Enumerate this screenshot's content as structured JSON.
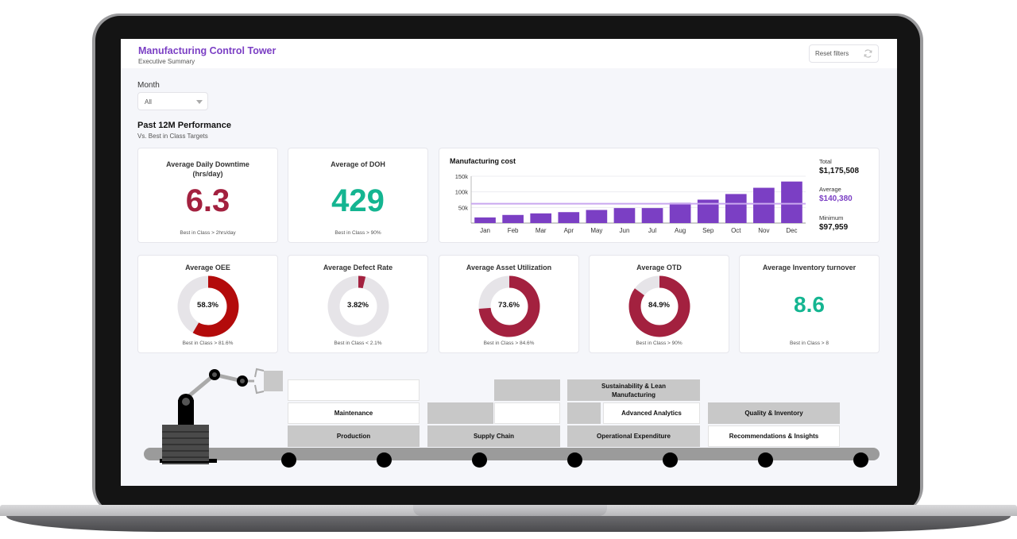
{
  "header": {
    "title": "Manufacturing Control Tower",
    "subtitle": "Executive Summary",
    "reset_label": "Reset filters"
  },
  "filters": {
    "month_label": "Month",
    "month_value": "All"
  },
  "section": {
    "title": "Past 12M Performance",
    "subtitle": "Vs. Best in Class Targets"
  },
  "kpis": {
    "downtime": {
      "title": "Average Daily Downtime (hrs/day)",
      "value": "6.3",
      "target": "Best in Class > 2hrs/day",
      "color": "#a3213f"
    },
    "doh": {
      "title": "Average of DOH",
      "value": "429",
      "target": "Best in Class > 90%",
      "color": "#14b591"
    },
    "inventory": {
      "title": "Average Inventory turnover",
      "value": "8.6",
      "target": "Best in Class > 8",
      "color": "#14b591"
    }
  },
  "donuts": [
    {
      "title": "Average OEE",
      "label": "58.3%",
      "percent": 58.3,
      "target": "Best in Class > 81.6%",
      "color": "#b30b0b"
    },
    {
      "title": "Average Defect Rate",
      "label": "3.82%",
      "percent": 3.82,
      "target": "Best in Class < 2.1%",
      "color": "#a3213f"
    },
    {
      "title": "Average Asset Utilization",
      "label": "73.6%",
      "percent": 73.6,
      "target": "Best in Class > 84.6%",
      "color": "#a3213f"
    },
    {
      "title": "Average OTD",
      "label": "84.9%",
      "percent": 84.9,
      "target": "Best in Class > 90%",
      "color": "#a3213f"
    }
  ],
  "cost_stats": {
    "total_label": "Total",
    "total_value": "$1,175,508",
    "average_label": "Average",
    "average_value": "$140,380",
    "minimum_label": "Minimum",
    "minimum_value": "$97,959",
    "average_color": "#7b3fc4"
  },
  "chart_data": {
    "type": "bar",
    "title": "Manufacturing cost",
    "categories": [
      "Jan",
      "Feb",
      "Mar",
      "Apr",
      "May",
      "Jun",
      "Jul",
      "Aug",
      "Sep",
      "Oct",
      "Nov",
      "Dec"
    ],
    "values": [
      18000,
      26000,
      31000,
      35000,
      42000,
      48000,
      48000,
      65000,
      75000,
      93000,
      113000,
      133000
    ],
    "reference_line": 62000,
    "ylim": [
      0,
      150000
    ],
    "yticks": [
      50000,
      100000,
      150000
    ],
    "ytick_labels": [
      "50k",
      "100k",
      "150k"
    ],
    "xlabel": "",
    "ylabel": "",
    "grid": true,
    "bar_color": "#7b3fc4",
    "line_color": "#c9a8ef"
  },
  "roadmap": {
    "blocks": [
      {
        "id": "empty-top-1",
        "label": "",
        "style": "white"
      },
      {
        "id": "maintenance",
        "label": "Maintenance",
        "style": "white"
      },
      {
        "id": "production",
        "label": "Production",
        "style": "gray"
      },
      {
        "id": "empty-top-2",
        "label": "",
        "style": "gray"
      },
      {
        "id": "empty-mid-2a",
        "label": "",
        "style": "gray"
      },
      {
        "id": "empty-mid-2b",
        "label": "",
        "style": "white"
      },
      {
        "id": "supply-chain",
        "label": "Supply Chain",
        "style": "gray"
      },
      {
        "id": "sustainability",
        "label": "Sustainability & Lean Manufacturing",
        "style": "gray"
      },
      {
        "id": "empty-mid-3",
        "label": "",
        "style": "gray"
      },
      {
        "id": "advanced-analytics",
        "label": "Advanced Analytics",
        "style": "white"
      },
      {
        "id": "opex",
        "label": "Operational Expenditure",
        "style": "gray"
      },
      {
        "id": "quality-inventory",
        "label": "Quality & Inventory",
        "style": "gray"
      },
      {
        "id": "recommendations",
        "label": "Recommendations & Insights",
        "style": "white"
      }
    ]
  }
}
